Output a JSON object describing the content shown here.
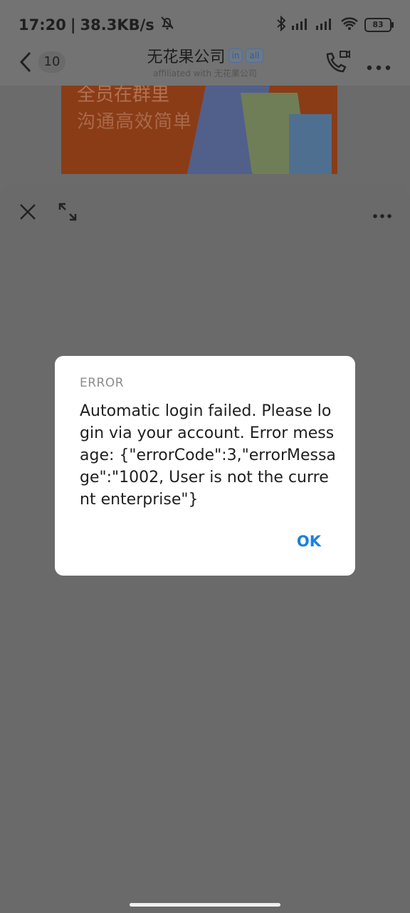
{
  "status_bar": {
    "time": "17:20",
    "separator": "|",
    "net_speed": "38.3KB/s",
    "battery": "83",
    "icons": [
      "mute-bell-icon",
      "bluetooth-icon",
      "signal-icon",
      "signal-icon",
      "wifi-icon",
      "battery-icon"
    ]
  },
  "chat_header": {
    "back_count": "10",
    "title": "无花果公司",
    "tags": [
      "in",
      "all"
    ],
    "subtitle": "affiliated with 无花果公司"
  },
  "banner": {
    "line1": "全员在群里",
    "line2": "沟通高效简单"
  },
  "dialog": {
    "title": "ERROR",
    "message": "Automatic login failed. Please login via your account. Error message: {\"errorCode\":3,\"errorMessage\":\"1002, User is not the current enterprise\"}",
    "ok_label": "OK"
  },
  "colors": {
    "accent": "#1a7fe0",
    "overlay": "#6b6b6b",
    "dialog_bg": "#ffffff"
  }
}
